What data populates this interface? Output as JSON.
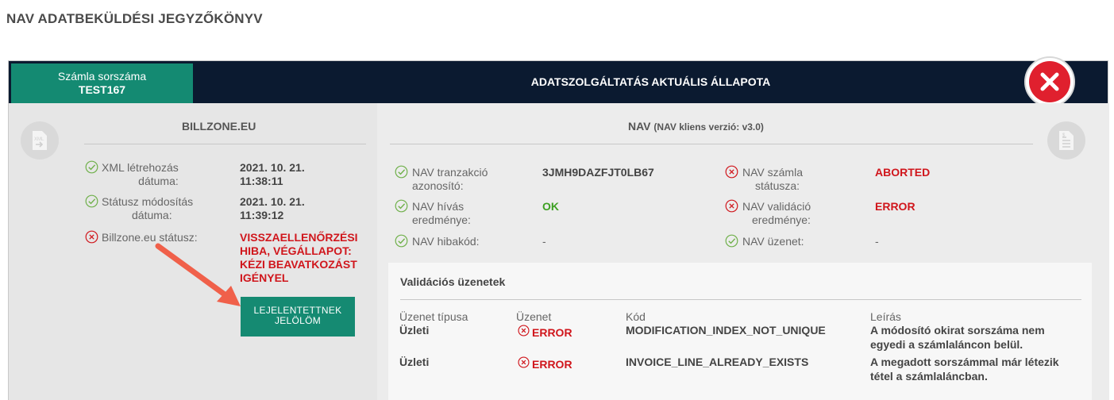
{
  "page_title": "NAV ADATBEKÜLDÉSI JEGYZŐKÖNYV",
  "header": {
    "invoice_label": "Számla sorszáma",
    "invoice_number": "TEST167",
    "title": "ADATSZOLGÁLTATÁS AKTUÁLIS ÁLLAPOTA"
  },
  "billzone": {
    "title": "BILLZONE.EU",
    "xml_label_1": "XML létrehozás",
    "xml_label_2": "dátuma:",
    "xml_date": "2021. 10. 21.",
    "xml_time": "11:38:11",
    "status_mod_label_1": "Státusz módosítás",
    "status_mod_label_2": "dátuma:",
    "status_mod_date": "2021. 10. 21.",
    "status_mod_time": "11:39:12",
    "status_label": "Billzone.eu státusz:",
    "status_value_1": "VISSZAELLENŐRZÉSI",
    "status_value_2": "HIBA, VÉGÁLLAPOT:",
    "status_value_3": "KÉZI BEAVATKOZÁST",
    "status_value_4": "IGÉNYEL",
    "report_button_1": "LEJELENTETTNEK",
    "report_button_2": "JELÖLÖM"
  },
  "nav": {
    "title": "NAV",
    "client_version": "(NAV kliens verzió: v3.0)",
    "tx_label_1": "NAV tranzakció",
    "tx_label_2": "azonosító:",
    "tx_value": "3JMH9DAZFJT0LB67",
    "call_label_1": "NAV hívás",
    "call_label_2": "eredménye:",
    "call_value": "OK",
    "errcode_label": "NAV hibakód:",
    "errcode_value": "-",
    "inv_status_label_1": "NAV számla",
    "inv_status_label_2": "státusza:",
    "inv_status_value": "ABORTED",
    "valid_label_1": "NAV validáció",
    "valid_label_2": "eredménye:",
    "valid_value": "ERROR",
    "message_label": "NAV üzenet:",
    "message_value": "-"
  },
  "validation": {
    "title": "Validációs üzenetek",
    "headers": {
      "type": "Üzenet típusa",
      "message": "Üzenet",
      "code": "Kód",
      "description": "Leírás"
    },
    "rows": [
      {
        "type": "Üzleti",
        "message": "ERROR",
        "code": "MODIFICATION_INDEX_NOT_UNIQUE",
        "desc_1": "A módosító okirat sorszáma nem",
        "desc_2": "egyedi a számlaláncon belül."
      },
      {
        "type": "Üzleti",
        "message": "ERROR",
        "code": "INVOICE_LINE_ALREADY_EXISTS",
        "desc_1": "A megadott sorszámmal már létezik",
        "desc_2": "tétel a számlaláncban."
      }
    ]
  },
  "colors": {
    "accent_green": "#148a72",
    "header_dark": "#0b1a30",
    "error_red": "#d0161c",
    "ok_green": "#3da022",
    "close_red": "#e0202e",
    "arrow": "#f0604a"
  }
}
